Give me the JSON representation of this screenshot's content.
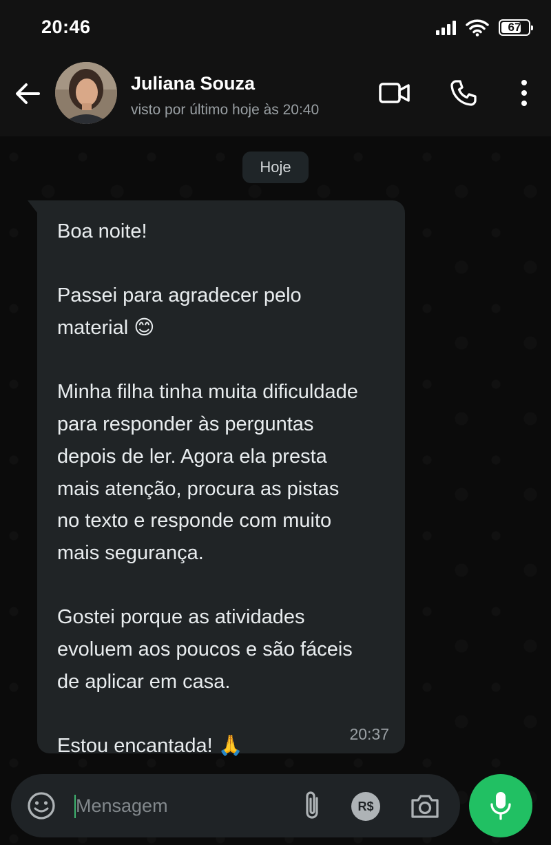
{
  "status_bar": {
    "time": "20:46",
    "battery_level": "67",
    "icons": [
      "signal-icon",
      "wifi-icon",
      "battery-icon"
    ]
  },
  "header": {
    "contact_name": "Juliana Souza",
    "contact_status": "visto por último hoje às 20:40",
    "icons": [
      "back-arrow-icon",
      "avatar",
      "video-call-icon",
      "phone-icon",
      "more-vertical-icon"
    ]
  },
  "chat": {
    "date_label": "Hoje",
    "message": {
      "paragraphs": [
        [
          "Boa noite!"
        ],
        [
          "Passei para agradecer pelo",
          "material 😊"
        ],
        [
          "Minha filha tinha muita dificuldade",
          "para responder às perguntas",
          "depois de ler. Agora ela presta",
          "mais atenção, procura as pistas",
          "no texto e responde com muito",
          "mais segurança."
        ],
        [
          "Gostei porque as atividades",
          "evoluem aos poucos e são fáceis",
          "de aplicar em casa."
        ],
        [
          "Estou encantada! 🙏"
        ]
      ],
      "time": "20:37"
    }
  },
  "input_bar": {
    "placeholder": "Mensagem",
    "pay_label": "R$",
    "icons": [
      "emoji-icon",
      "attach-icon",
      "payment-icon",
      "camera-icon",
      "mic-icon"
    ]
  },
  "colors": {
    "header_bg": "#121212",
    "chat_bg": "#0b0b0b",
    "bubble_bg": "#202426",
    "accent_green": "#21c063"
  }
}
